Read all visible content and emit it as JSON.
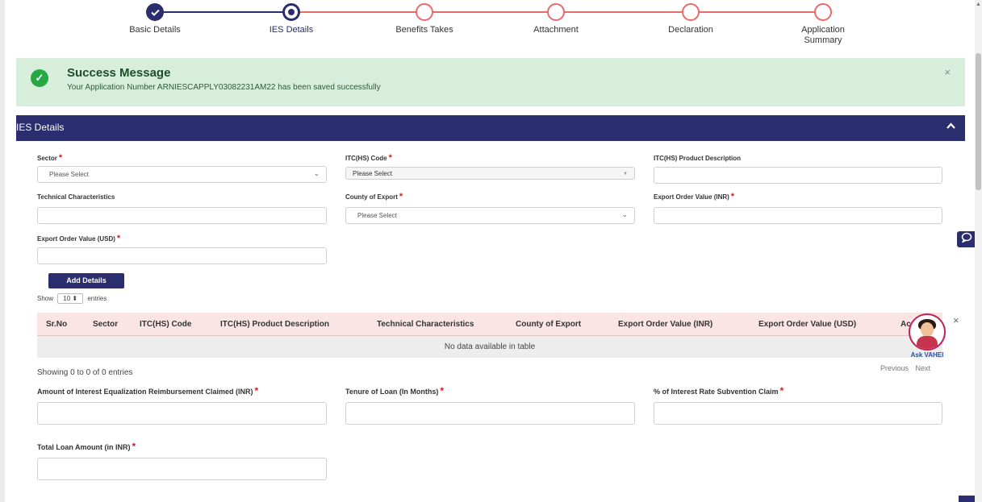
{
  "stepper": {
    "steps": [
      {
        "label": "Basic Details",
        "state": "done"
      },
      {
        "label": "IES Details",
        "state": "active"
      },
      {
        "label": "Benefits Takes",
        "state": "pending"
      },
      {
        "label": "Attachment",
        "state": "pending"
      },
      {
        "label": "Declaration",
        "state": "pending"
      },
      {
        "label": "Application Summary",
        "state": "pending"
      }
    ]
  },
  "alert": {
    "title": "Success Message",
    "message": "Your Application Number ARNIESCAPPLY03082231AM22 has been saved successfully",
    "close": "×"
  },
  "panel": {
    "title": "IES Details",
    "toggle": "⌃"
  },
  "form": {
    "sector": {
      "label": "Sector",
      "placeholder": "Please Select"
    },
    "itc_code": {
      "label": "ITC(HS) Code",
      "placeholder": "Please Select"
    },
    "itc_desc": {
      "label": "ITC(HS) Product Description"
    },
    "tech": {
      "label": "Technical Characteristics"
    },
    "county": {
      "label": "County of Export",
      "placeholder": "Please Select"
    },
    "inr": {
      "label": "Export Order Value (INR)"
    },
    "usd": {
      "label": "Export Order Value (USD)"
    },
    "add_button": "Add Details",
    "claim": {
      "label": "Amount of Interest Equalization Reimbursement Claimed (INR)"
    },
    "tenure": {
      "label": "Tenure of Loan (In Months)"
    },
    "rate": {
      "label": "% of Interest Rate Subvention Claim"
    },
    "total": {
      "label": "Total Loan Amount (in INR)"
    }
  },
  "table": {
    "show_prefix": "Show",
    "show_value": "10",
    "show_suffix": "entries",
    "columns": [
      "Sr.No",
      "Sector",
      "ITC(HS) Code",
      "ITC(HS) Product Description",
      "Technical Characteristics",
      "County of Export",
      "Export Order Value (INR)",
      "Export Order Value (USD)",
      "Ac"
    ],
    "empty": "No data available in table",
    "showing": "Showing 0 to 0 of 0 entries",
    "previous": "Previous",
    "next": "Next"
  },
  "assistant": {
    "name": "Ask VAHEI",
    "close": "×"
  },
  "colors": {
    "primary": "#2a2d6e",
    "pending": "#e86a6a",
    "success_bg": "#d6eedb",
    "required": "#d02020"
  }
}
